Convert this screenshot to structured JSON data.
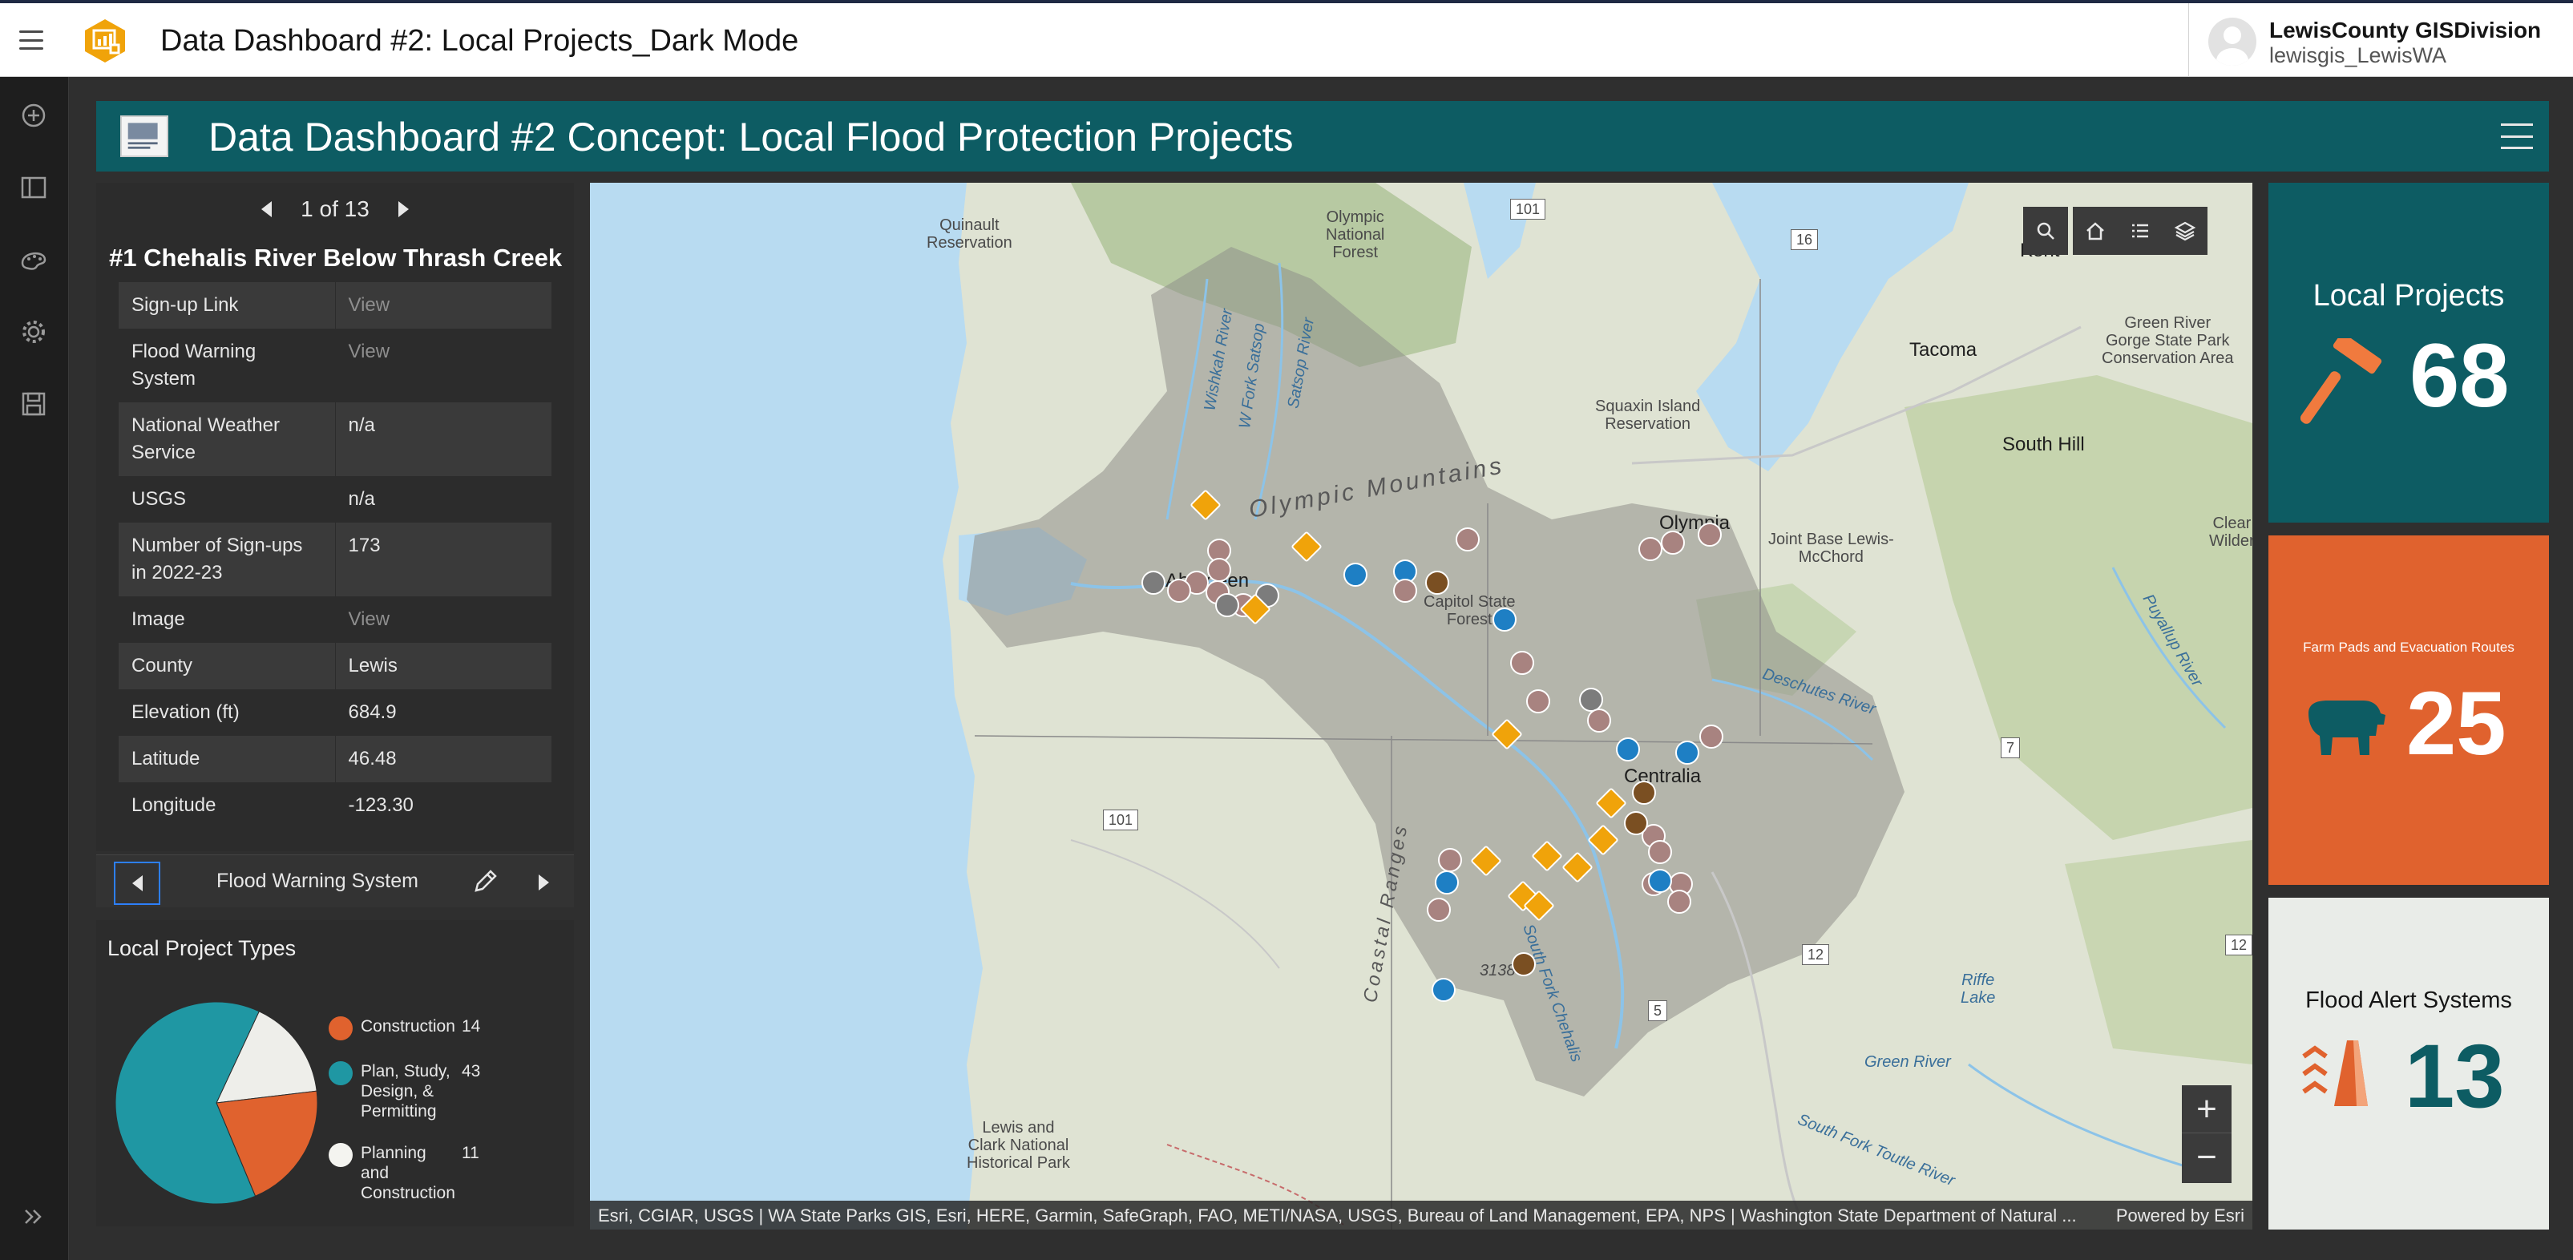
{
  "app": {
    "title": "Data Dashboard #2: Local Projects_Dark Mode",
    "user_name": "LewisCounty GISDivision",
    "user_id": "lewisgis_LewisWA"
  },
  "dashboard": {
    "title": "Data Dashboard #2 Concept: Local Flood Protection Projects"
  },
  "details": {
    "pager": "1 of 13",
    "feature_title": "#1 Chehalis River Below Thrash Creek",
    "rows": [
      {
        "key": "Sign-up Link",
        "value": "View"
      },
      {
        "key": "Flood Warning System",
        "value": "View"
      },
      {
        "key": "National Weather Service",
        "value": "n/a"
      },
      {
        "key": "USGS",
        "value": "n/a"
      },
      {
        "key": "Number of Sign-ups in 2022-23",
        "value": "173"
      },
      {
        "key": "Image",
        "value": "View"
      },
      {
        "key": "County",
        "value": "Lewis"
      },
      {
        "key": "Elevation (ft)",
        "value": "684.9"
      },
      {
        "key": "Latitude",
        "value": "46.48"
      },
      {
        "key": "Longitude",
        "value": "-123.30"
      }
    ],
    "footer_label": "Flood Warning System"
  },
  "pie": {
    "title": "Local Project Types",
    "colors": [
      "#e0622e",
      "#1f97a3",
      "#eeeeea"
    ]
  },
  "chart_data": {
    "type": "pie",
    "title": "Local Project Types",
    "categories": [
      "Construction",
      "Plan, Study, Design, & Permitting",
      "Planning and Construction"
    ],
    "values": [
      14,
      43,
      11
    ]
  },
  "map": {
    "attribution": "Esri, CGIAR, USGS | WA State Parks GIS, Esri, HERE, Garmin, SafeGraph, FAO, METI/NASA, USGS, Bureau of Land Management, EPA, NPS | Washington State Department of Natural ...",
    "powered_by": "Powered by Esri",
    "labels": {
      "quinault": "Quinault\nReservation",
      "olympic_nf": "Olympic\nNational\nForest",
      "olympic_mtns": "Olympic Mountains",
      "aberdeen": "Aberdeen",
      "capitol": "Capitol State\nForest",
      "olympia": "Olympia",
      "squaxin": "Squaxin Island\nReservation",
      "tacoma": "Tacoma",
      "south_hill": "South Hill",
      "kent": "Kent",
      "green_river": "Green River\nGorge State Park\nConservation Area",
      "joint_base": "Joint Base Lewis-\nMcChord",
      "centralia": "Centralia",
      "coastal": "Coastal Ranges",
      "lewis_clark": "Lewis and\nClark National\nHistorical Park",
      "deschutes": "Deschutes River",
      "riffe": "Riffe\nLake",
      "green_r2": "Green River",
      "puyallup": "Puyallup River",
      "clear": "Clear\nWilder",
      "wishkah": "Wishkah River",
      "satsop": "Satsop River",
      "wynoochee": "W Fork Satsop",
      "skookum": "South Fork Chehalis",
      "south_toutle": "South Fork Toutle River",
      "h101a": "101",
      "h101b": "101",
      "h16": "16",
      "h7": "7",
      "h12a": "12",
      "h12b": "12",
      "h5": "5",
      "elev": "3138"
    }
  },
  "indicators": {
    "local_projects": {
      "title": "Local Projects",
      "value": "68",
      "color": "#0d5c63"
    },
    "farm_pads": {
      "title": "Farm Pads and Evacuation Routes",
      "value": "25",
      "color": "#e0622e"
    },
    "flood_alert": {
      "title": "Flood Alert Systems",
      "value": "13",
      "color": "#e9ece8"
    }
  }
}
